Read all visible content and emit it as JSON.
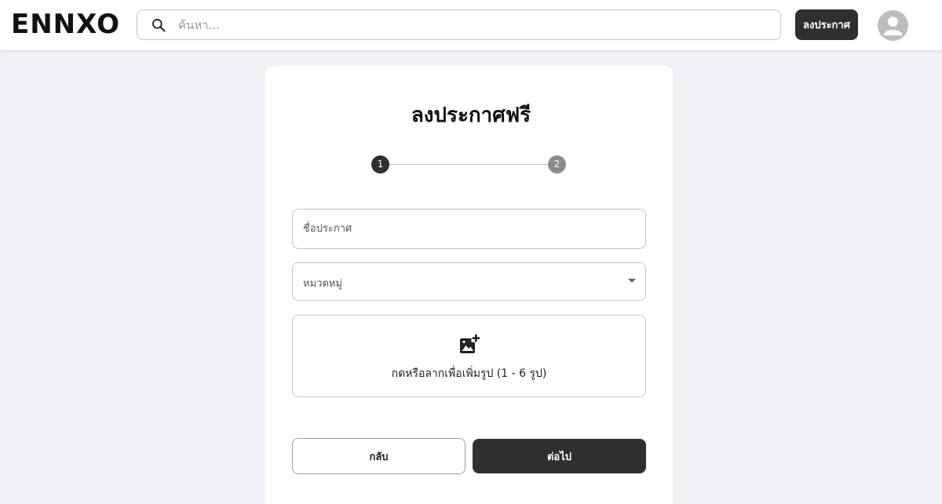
{
  "header": {
    "logo": "ENNXO",
    "search_placeholder": "ค้นหา...",
    "post_button_label": "ลงประกาศ"
  },
  "form": {
    "title": "ลงประกาศฟรี",
    "steps": [
      "1",
      "2"
    ],
    "current_step": 1,
    "title_field_placeholder": "ชื่อประกาศ",
    "category_label": "หมวดหมู่",
    "upload_text": "กดหรือลากเพื่อเพิ่มรูป (1 - 6 รูป)",
    "back_label": "กลับ",
    "next_label": "ต่อไป"
  },
  "icons": {
    "search": "search-icon",
    "avatar": "account-circle-icon",
    "dropdown": "chevron-down-icon",
    "upload": "add-photo-icon"
  },
  "colors": {
    "primary": "#2f2f2f",
    "step_inactive": "#8a8a8a",
    "background": "#f1f2f5"
  }
}
